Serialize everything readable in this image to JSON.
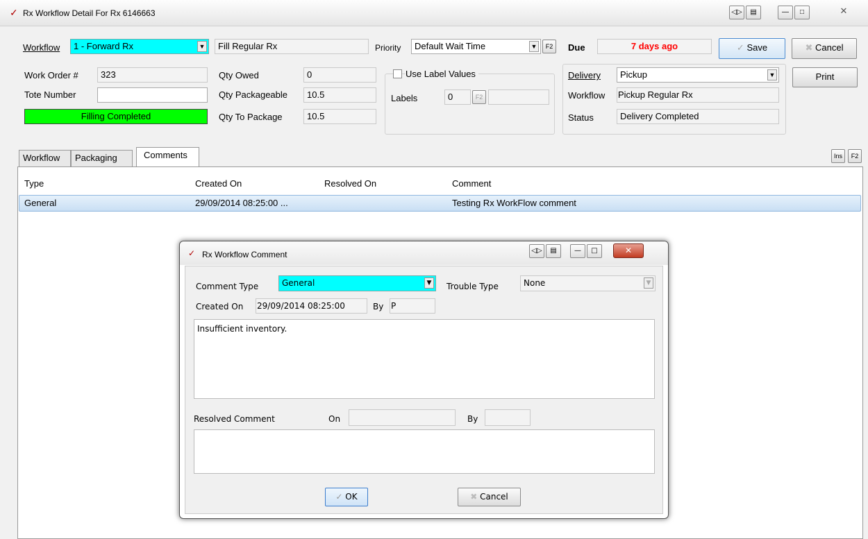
{
  "window": {
    "title": "Rx Workflow Detail For Rx 6146663"
  },
  "toolbar": {
    "workflow_label": "Workflow",
    "workflow_value": "1 - Forward Rx",
    "fill_type": "Fill Regular Rx",
    "priority_label": "Priority",
    "priority_value": "Default Wait Time",
    "due_label": "Due",
    "due_value": "7 days ago",
    "save_label": "Save",
    "cancel_label": "Cancel",
    "f2": "F2"
  },
  "info": {
    "work_order_label": "Work Order #",
    "work_order_value": "323",
    "tote_label": "Tote Number",
    "tote_value": "",
    "status_bar": "Filling Completed",
    "qty_owed_label": "Qty Owed",
    "qty_owed_value": "0",
    "qty_packageable_label": "Qty Packageable",
    "qty_packageable_value": "10.5",
    "qty_to_package_label": "Qty To Package",
    "qty_to_package_value": "10.5",
    "use_label_values": "Use Label Values",
    "labels_label": "Labels",
    "labels_value": "0",
    "delivery_label": "Delivery",
    "delivery_value": "Pickup",
    "workflow_label": "Workflow",
    "workflow_value": "Pickup Regular Rx",
    "status_label": "Status",
    "status_value": "Delivery Completed",
    "print_label": "Print"
  },
  "tabs": [
    {
      "label": "Workflow"
    },
    {
      "label": "Packaging"
    },
    {
      "label": "Comments"
    }
  ],
  "tab_buttons": {
    "ins": "Ins",
    "f2": "F2"
  },
  "grid": {
    "columns": [
      "Type",
      "Created On",
      "Resolved On",
      "Comment"
    ],
    "rows": [
      [
        "General",
        "29/09/2014 08:25:00 ...",
        "",
        "Testing Rx WorkFlow comment"
      ]
    ]
  },
  "dialog": {
    "title": "Rx Workflow Comment",
    "comment_type_label": "Comment Type",
    "comment_type_value": "General",
    "trouble_type_label": "Trouble Type",
    "trouble_type_value": "None",
    "created_on_label": "Created On",
    "created_on_value": "29/09/2014 08:25:00",
    "by_label": "By",
    "by_value": "P",
    "comment_text": "Insufficient inventory.",
    "resolved_comment_label": "Resolved Comment",
    "on_label": "On",
    "on_value": "",
    "by2_label": "By",
    "by2_value": "",
    "resolved_text": "",
    "ok_label": "OK",
    "cancel_label": "Cancel"
  },
  "colors": {
    "accent_cyan": "#00ffff",
    "status_green": "#00ff00",
    "due_red": "#ff0000",
    "row_select": "#cfe4f7"
  }
}
